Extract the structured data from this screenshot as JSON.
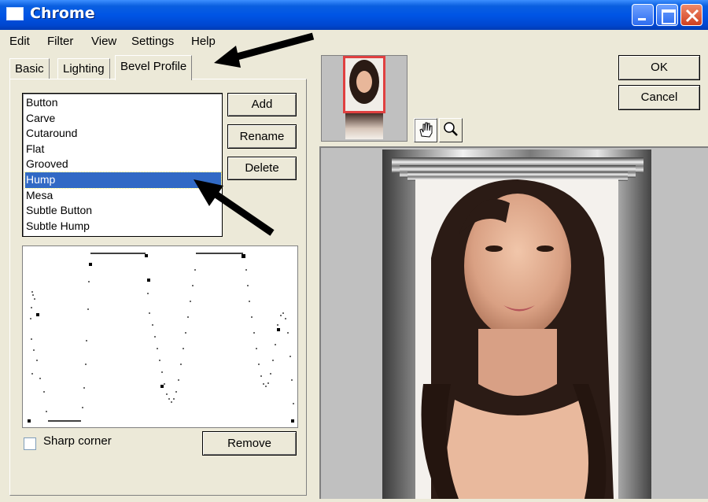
{
  "window": {
    "title": "Chrome"
  },
  "menu": [
    "Edit",
    "Filter",
    "View",
    "Settings",
    "Help"
  ],
  "tabs": [
    "Basic",
    "Lighting",
    "Bevel Profile"
  ],
  "active_tab": "Bevel Profile",
  "profiles": [
    "Button",
    "Carve",
    "Cutaround",
    "Flat",
    "Grooved",
    "Hump",
    "Mesa",
    "Subtle Button",
    "Subtle Hump"
  ],
  "selected_profile": "Hump",
  "buttons": {
    "add": "Add",
    "rename": "Rename",
    "delete": "Delete",
    "remove": "Remove",
    "ok": "OK",
    "cancel": "Cancel"
  },
  "sharp_corner": {
    "label": "Sharp corner",
    "checked": false
  },
  "tools": [
    "hand-icon",
    "magnifier-icon"
  ],
  "colors": {
    "title_bar": "#0055e5",
    "selection": "#316ac5",
    "thumbnail_border": "#e04040"
  }
}
